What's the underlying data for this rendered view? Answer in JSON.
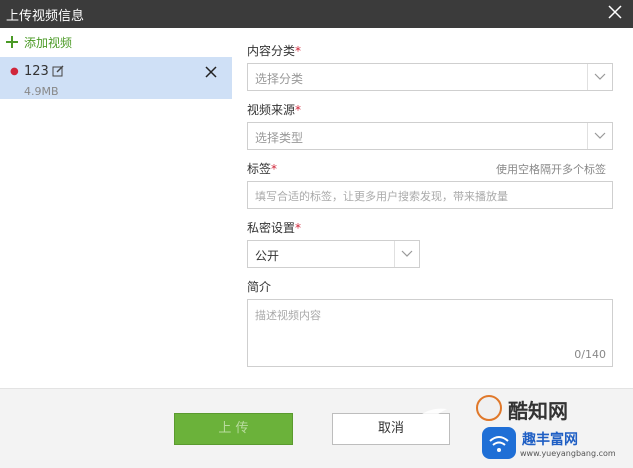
{
  "dialog": {
    "title": "上传视频信息"
  },
  "sidebar": {
    "add_label": "添加视频",
    "file": {
      "name": "123",
      "size": "4.9MB"
    }
  },
  "form": {
    "category": {
      "label": "内容分类",
      "required": "*",
      "value": "选择分类"
    },
    "source": {
      "label": "视频来源",
      "required": "*",
      "value": "选择类型"
    },
    "tags": {
      "label": "标签",
      "required": "*",
      "hint": "使用空格隔开多个标签",
      "placeholder": "填写合适的标签，让更多用户搜索发现，带来播放量"
    },
    "privacy": {
      "label": "私密设置",
      "required": "*",
      "value": "公开"
    },
    "intro": {
      "label": "简介",
      "placeholder": "描述视频内容",
      "count": "0/140"
    }
  },
  "footer": {
    "upload_label": "上 传",
    "cancel_label": "取消"
  },
  "watermark": {
    "brand1": "酷知网",
    "brand2": "趣丰富网",
    "url": "www.yueyangbang.com"
  },
  "colors": {
    "accent_green": "#6bb23a",
    "required_red": "#d0263a",
    "title_bar": "#3b3b3b",
    "selected_row": "#cfe0f6"
  }
}
